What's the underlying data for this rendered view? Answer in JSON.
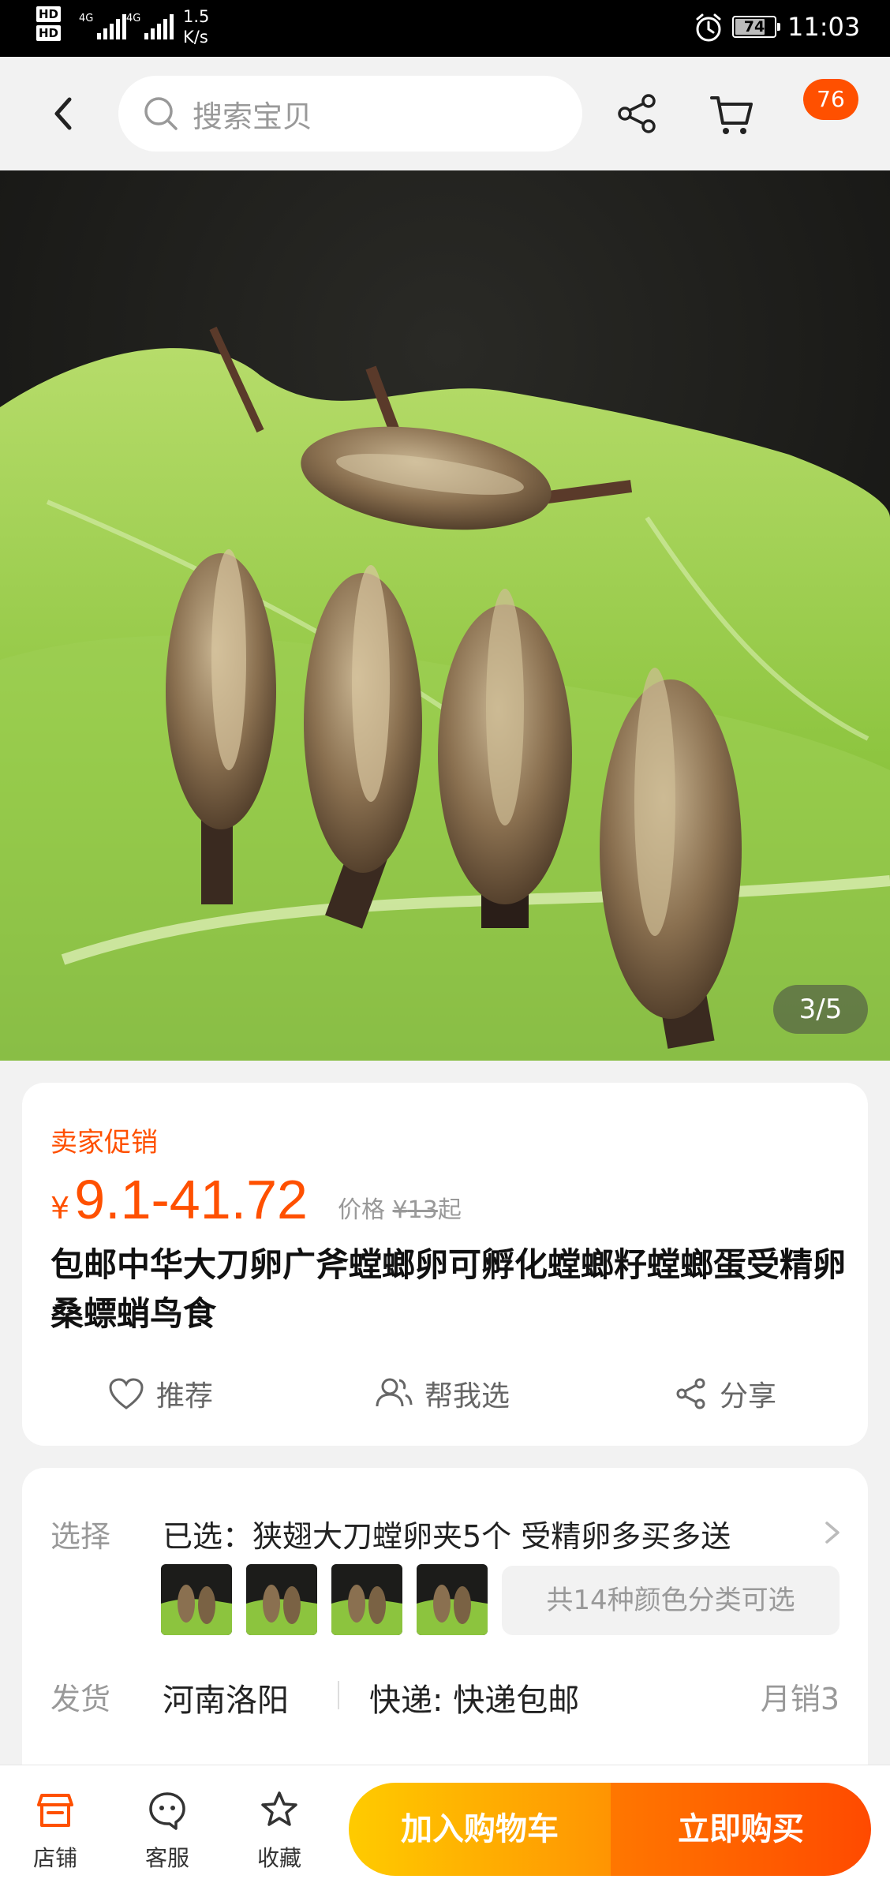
{
  "status_bar": {
    "hd1": "HD",
    "hd2": "HD",
    "net1": "4G",
    "net2": "4G",
    "speed_value": "1.5",
    "speed_unit": "K/s",
    "battery": "74",
    "time": "11:03"
  },
  "nav": {
    "search_placeholder": "搜索宝贝",
    "cart_badge": "76"
  },
  "gallery": {
    "counter": "3/5"
  },
  "product": {
    "promo_label": "卖家促销",
    "currency": "¥",
    "price_range": "9.1-41.72",
    "orig_prefix": "价格",
    "orig_currency": "¥",
    "orig_price": "13",
    "orig_suffix": "起",
    "title": "包邮中华大刀卵广斧螳螂卵可孵化螳螂籽螳螂蛋受精卵桑螵蛸鸟食",
    "actions": {
      "recommend": "推荐",
      "help_choose": "帮我选",
      "share": "分享"
    }
  },
  "spec": {
    "select_label": "选择",
    "selected_text": "已选：狭翅大刀螳卵夹5个 受精卵多买多送",
    "variant_summary": "共14种颜色分类可选",
    "ship_label": "发货",
    "ship_location": "河南洛阳",
    "ship_express": "快递: 快递包邮",
    "monthly_sales": "月销3"
  },
  "bottom_bar": {
    "store": "店铺",
    "service": "客服",
    "favorite": "收藏",
    "add_to_cart": "加入购物车",
    "buy_now": "立即购买"
  },
  "colors": {
    "accent": "#ff5000",
    "cart_button": "#ffa400",
    "buy_button": "#ff5a00"
  }
}
